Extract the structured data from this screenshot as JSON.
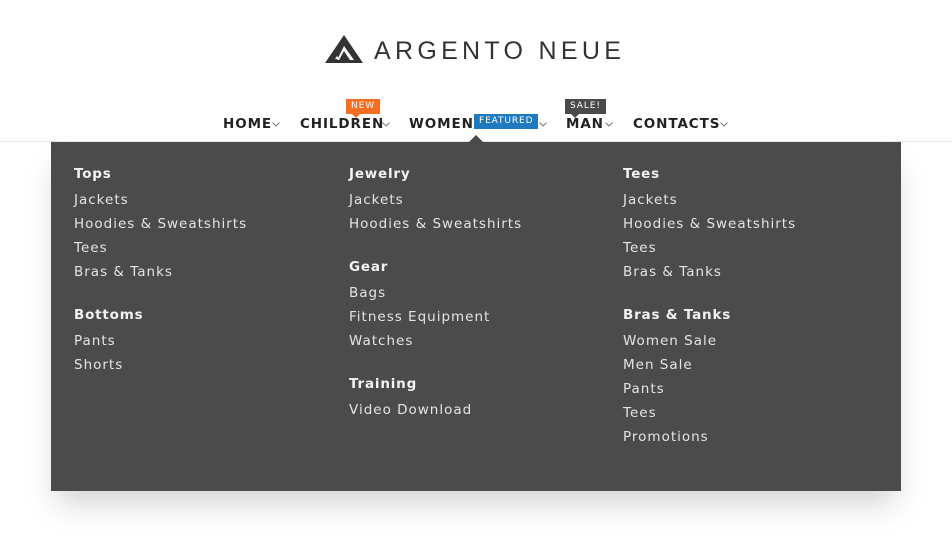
{
  "brand": {
    "name": "ARGENTO NEUE",
    "logo_icon": "argento-logo-icon"
  },
  "nav": {
    "items": [
      {
        "label": "HOME"
      },
      {
        "label": "CHILDREN",
        "badge": "NEW"
      },
      {
        "label": "WOMEN",
        "badge": "FEATURED",
        "active": true
      },
      {
        "label": "MAN",
        "badge": "SALE!"
      },
      {
        "label": "CONTACTS"
      }
    ]
  },
  "colors": {
    "badge_new": "#f36e20",
    "badge_featured": "#1f7ac0",
    "badge_sale": "#4a4a4a",
    "menu_bg": "#4b4b4b"
  },
  "megamenu": {
    "columns": [
      {
        "groups": [
          {
            "title": "Tops",
            "links": [
              "Jackets",
              "Hoodies & Sweatshirts",
              "Tees",
              "Bras & Tanks"
            ]
          },
          {
            "title": "Bottoms",
            "links": [
              "Pants",
              "Shorts"
            ]
          }
        ]
      },
      {
        "groups": [
          {
            "title": "Jewelry",
            "links": [
              "Jackets",
              "Hoodies & Sweatshirts"
            ]
          },
          {
            "title": "Gear",
            "links": [
              "Bags",
              "Fitness Equipment",
              "Watches"
            ]
          },
          {
            "title": "Training",
            "links": [
              "Video Download"
            ]
          }
        ]
      },
      {
        "groups": [
          {
            "title": "Tees",
            "links": [
              "Jackets",
              "Hoodies & Sweatshirts",
              "Tees",
              "Bras & Tanks"
            ]
          },
          {
            "title": "Bras & Tanks",
            "links": [
              "Women Sale",
              "Men Sale",
              "Pants",
              "Tees",
              "Promotions"
            ]
          }
        ]
      }
    ]
  }
}
